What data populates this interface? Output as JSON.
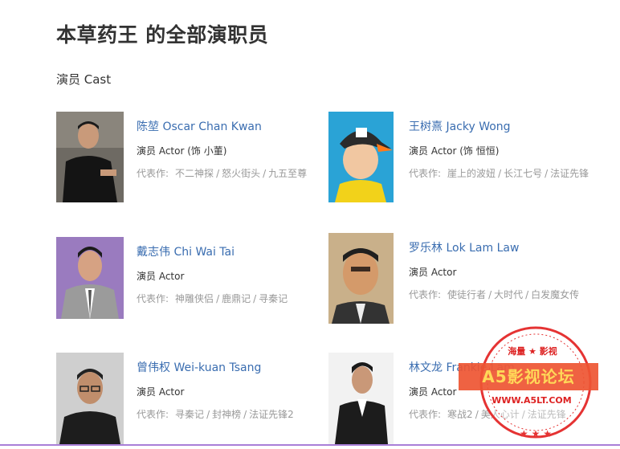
{
  "page": {
    "title": "本草药王 的全部演职员"
  },
  "cast_section": {
    "title": "演员 Cast"
  },
  "works_label": "代表作:",
  "cast": [
    {
      "name": "陈堃 Oscar Chan Kwan",
      "role": "演员 Actor (饰 小董)",
      "works": [
        "不二神探",
        "怒火街头",
        "九五至尊"
      ]
    },
    {
      "name": "王树熹 Jacky Wong",
      "role": "演员 Actor (饰 恒恒)",
      "works": [
        "崖上的波妞",
        "长江七号",
        "法证先锋"
      ]
    },
    {
      "name": "戴志伟 Chi Wai Tai",
      "role": "演员 Actor",
      "works": [
        "神雕侠侣",
        "鹿鼎记",
        "寻秦记"
      ]
    },
    {
      "name": "罗乐林 Lok Lam Law",
      "role": "演员 Actor",
      "works": [
        "使徒行者",
        "大时代",
        "白发魔女传"
      ]
    },
    {
      "name": "曾伟权 Wei-kuan Tsang",
      "role": "演员 Actor",
      "works": [
        "寻秦记",
        "封神榜",
        "法证先锋2"
      ]
    },
    {
      "name": "林文龙 Frankie Lam",
      "role": "演员 Actor",
      "works": [
        "寒战2",
        "美人心计",
        "法证先锋"
      ]
    }
  ],
  "watermark": {
    "top": "海量 ★ 影视",
    "main": "A5影视论坛",
    "url": "WWW.A5LT.COM"
  },
  "colors": {
    "link": "#3a6db0",
    "muted": "#999999",
    "stamp": "#e53333"
  }
}
